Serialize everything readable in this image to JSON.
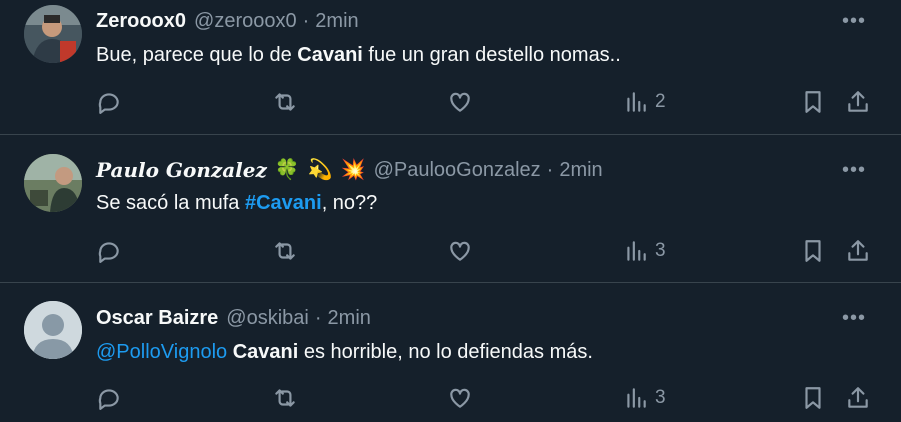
{
  "tweets": [
    {
      "name": "Zerooox0",
      "handle": "@zerooox0",
      "sep": "·",
      "time": "2min",
      "emojis": [],
      "text_segments": [
        "Bue, parece que lo de ",
        "Cavani",
        " fue un gran destello nomas.."
      ],
      "views": "2",
      "avatar": "photo"
    },
    {
      "name": "Paulo Gonzalez",
      "handle": "@PaulooGonzalez",
      "sep": "·",
      "time": "2min",
      "emojis": [
        "🍀",
        "💫",
        "💥"
      ],
      "text_segments": [
        "Se sacó la mufa ",
        "#Cavani",
        ", no??"
      ],
      "views": "3",
      "avatar": "photo"
    },
    {
      "name": "Oscar Baizre",
      "handle": "@oskibai",
      "sep": "·",
      "time": "2min",
      "emojis": [],
      "text_segments": [
        "@PolloVignolo",
        " ",
        "Cavani",
        " es horrible, no lo defiendas más."
      ],
      "views": "3",
      "avatar": "default"
    }
  ],
  "more_label": "•••",
  "colors": {
    "background": "#15202b",
    "link": "#1d9bf0",
    "muted": "#8b98a5",
    "divider": "#38444d"
  }
}
